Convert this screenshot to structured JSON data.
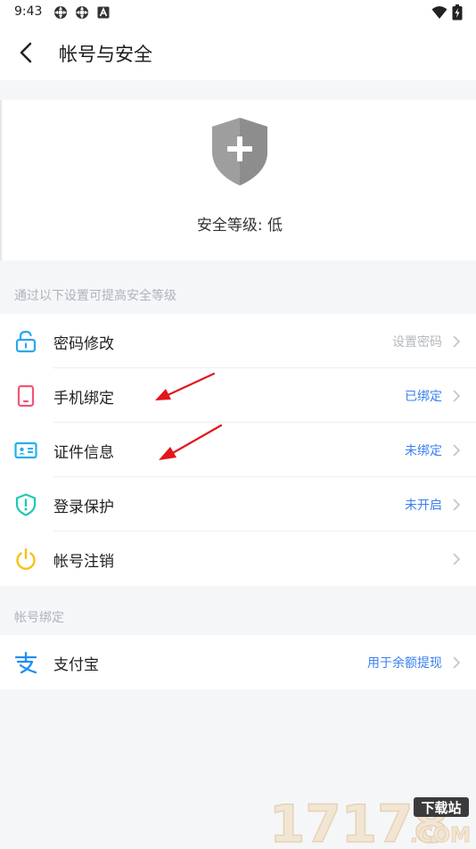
{
  "status_bar": {
    "time": "9:43"
  },
  "header": {
    "title": "帐号与安全"
  },
  "security": {
    "level_text": "安全等级: 低"
  },
  "hint": "通过以下设置可提高安全等级",
  "items": [
    {
      "label": "密码修改",
      "status": "设置密码",
      "icon": "unlock-icon",
      "icon_color": "#2aa6f0",
      "status_color": "#b4b8bf"
    },
    {
      "label": "手机绑定",
      "status": "已绑定",
      "icon": "phone-icon",
      "icon_color": "#f25576",
      "status_color": "#3a7ff0"
    },
    {
      "label": "证件信息",
      "status": "未绑定",
      "icon": "id-card-icon",
      "icon_color": "#20b0ee",
      "status_color": "#3a7ff0"
    },
    {
      "label": "登录保护",
      "status": "未开启",
      "icon": "shield-alert-icon",
      "icon_color": "#1fc9b5",
      "status_color": "#3a7ff0"
    },
    {
      "label": "帐号注销",
      "status": "",
      "icon": "power-icon",
      "icon_color": "#f6c315",
      "status_color": "#b4b8bf"
    }
  ],
  "binding_section": {
    "title": "帐号绑定",
    "items": [
      {
        "label": "支付宝",
        "status": "用于余额提现",
        "icon": "alipay-icon",
        "icon_color": "#1e8ff3",
        "status_color": "#3a7ff0"
      }
    ]
  },
  "watermark": {
    "main": "17178",
    "tag": "下载站",
    "suffix": ".COM"
  },
  "colors": {
    "background": "#f5f6f8",
    "accent": "#3a7ff0",
    "arrow": "#e3141b",
    "shield": "#9e9e9e"
  }
}
